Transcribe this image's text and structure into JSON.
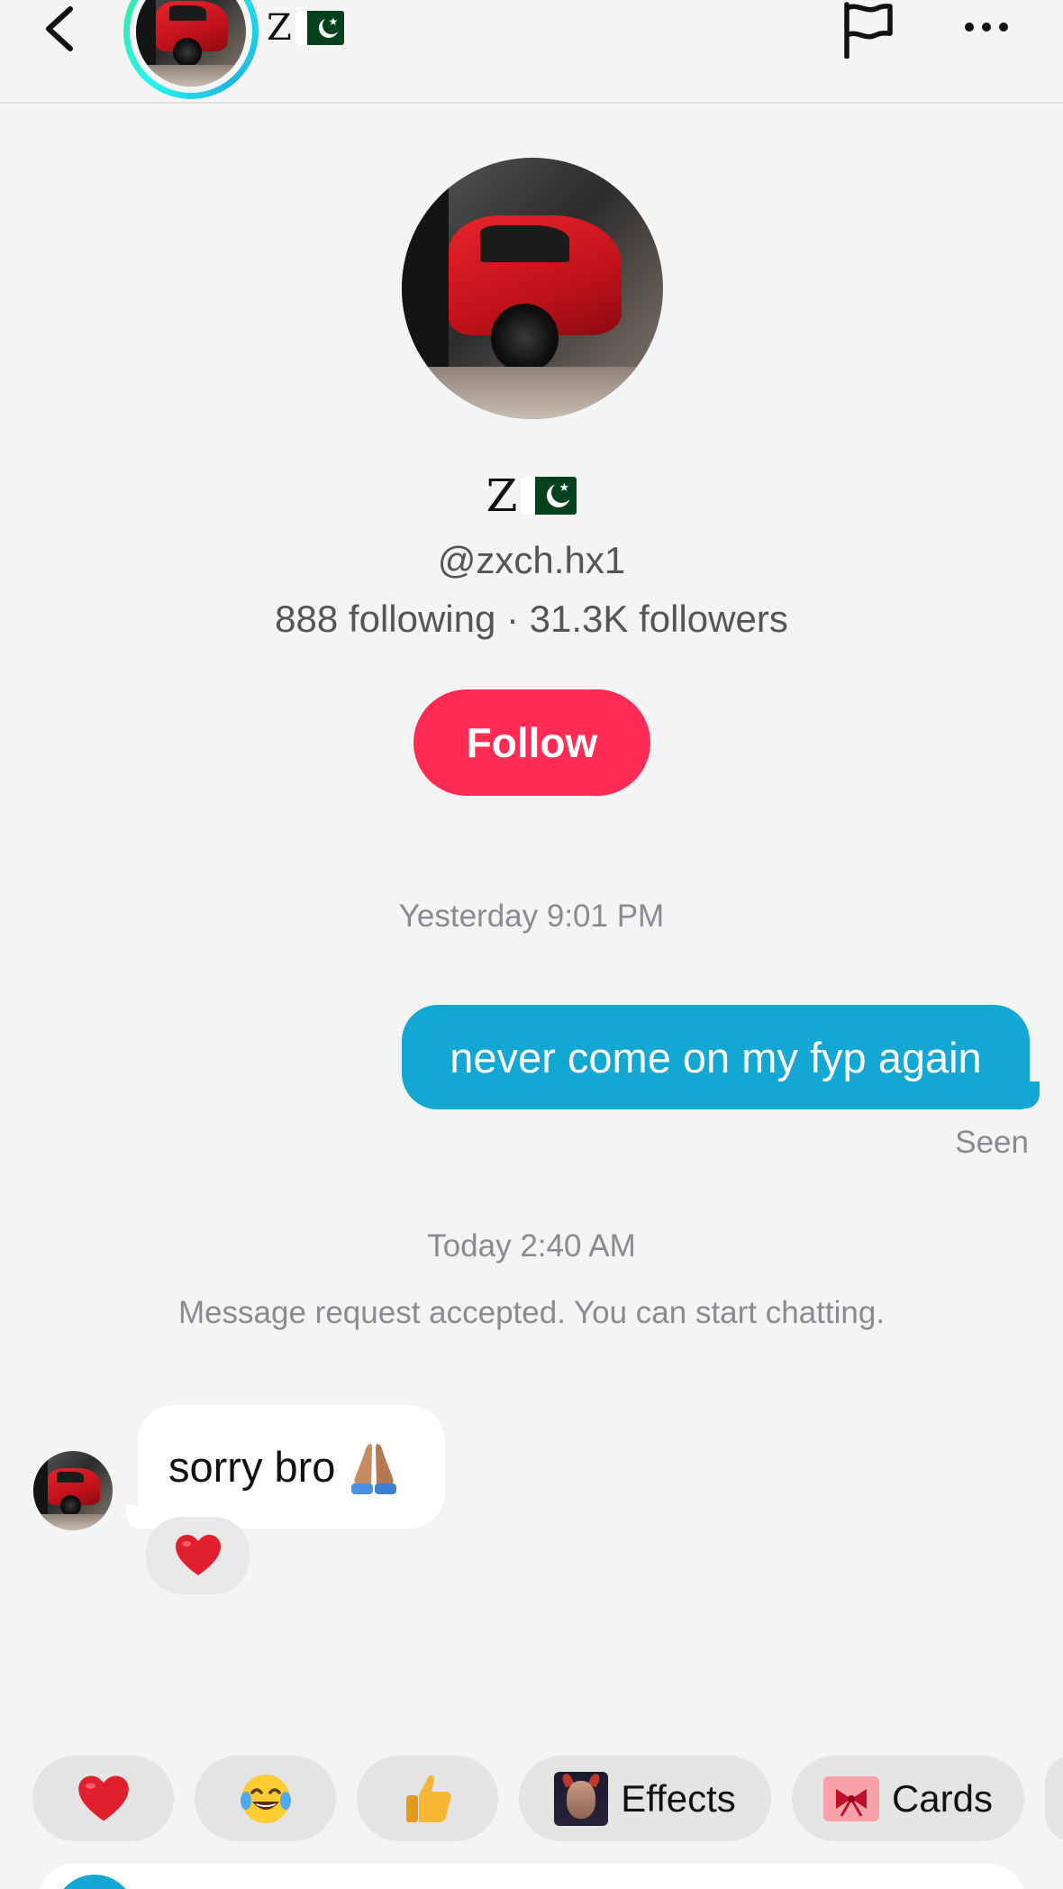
{
  "header": {
    "display_name": "Z",
    "flag": "pakistan-flag-icon",
    "back_icon": "chevron-left-icon",
    "report_icon": "flag-outline-icon",
    "more_icon": "ellipsis-icon",
    "story_ring_color": "#25f4ee"
  },
  "profile": {
    "display_name": "Z",
    "handle": "@zxch.hx1",
    "stats": "888 following · 31.3K followers",
    "follow_label": "Follow",
    "follow_color": "#fe2c55"
  },
  "conversation": {
    "timestamp_1": "Yesterday 9:01 PM",
    "outgoing_message": "never come on my fyp again",
    "outgoing_status": "Seen",
    "outgoing_color": "#13a8d4",
    "timestamp_2": "Today 2:40 AM",
    "system_note": "Message request accepted. You can start chatting.",
    "incoming_message": "sorry bro",
    "incoming_emoji": "folded-hands-emoji",
    "reaction": "red-heart-emoji"
  },
  "quick_replies": {
    "heart": "red-heart-emoji",
    "laugh": "tears-of-joy-emoji",
    "thumb": "thumbs-up-emoji",
    "effects_label": "Effects",
    "cards_label": "Cards"
  }
}
